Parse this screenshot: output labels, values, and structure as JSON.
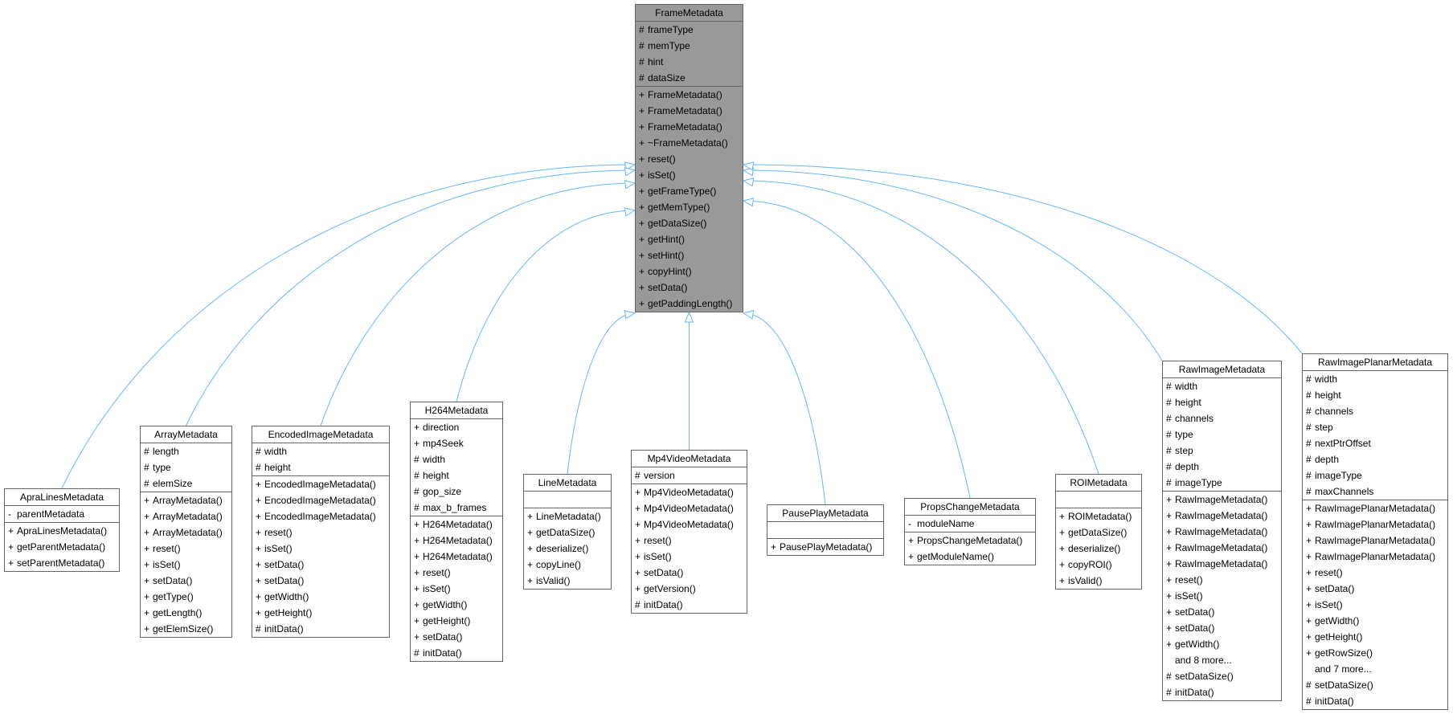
{
  "diagram": {
    "type": "class-inheritance",
    "edge_color": "#63b8ff",
    "base": {
      "name": "FrameMetadata",
      "attributes": [
        {
          "vis": "#",
          "name": "frameType"
        },
        {
          "vis": "#",
          "name": "memType"
        },
        {
          "vis": "#",
          "name": "hint"
        },
        {
          "vis": "#",
          "name": "dataSize"
        }
      ],
      "methods": [
        {
          "vis": "+",
          "name": "FrameMetadata()"
        },
        {
          "vis": "+",
          "name": "FrameMetadata()"
        },
        {
          "vis": "+",
          "name": "FrameMetadata()"
        },
        {
          "vis": "+",
          "name": "~FrameMetadata()"
        },
        {
          "vis": "+",
          "name": "reset()"
        },
        {
          "vis": "+",
          "name": "isSet()"
        },
        {
          "vis": "+",
          "name": "getFrameType()"
        },
        {
          "vis": "+",
          "name": "getMemType()"
        },
        {
          "vis": "+",
          "name": "getDataSize()"
        },
        {
          "vis": "+",
          "name": "getHint()"
        },
        {
          "vis": "+",
          "name": "setHint()"
        },
        {
          "vis": "+",
          "name": "copyHint()"
        },
        {
          "vis": "+",
          "name": "setData()"
        },
        {
          "vis": "+",
          "name": "getPaddingLength()"
        }
      ]
    },
    "classes": [
      {
        "name": "ApraLinesMetadata",
        "attributes": [
          {
            "vis": "-",
            "name": "parentMetadata"
          }
        ],
        "methods": [
          {
            "vis": "+",
            "name": "ApraLinesMetadata()"
          },
          {
            "vis": "+",
            "name": "getParentMetadata()"
          },
          {
            "vis": "+",
            "name": "setParentMetadata()"
          }
        ]
      },
      {
        "name": "ArrayMetadata",
        "attributes": [
          {
            "vis": "#",
            "name": "length"
          },
          {
            "vis": "#",
            "name": "type"
          },
          {
            "vis": "#",
            "name": "elemSize"
          }
        ],
        "methods": [
          {
            "vis": "+",
            "name": "ArrayMetadata()"
          },
          {
            "vis": "+",
            "name": "ArrayMetadata()"
          },
          {
            "vis": "+",
            "name": "ArrayMetadata()"
          },
          {
            "vis": "+",
            "name": "reset()"
          },
          {
            "vis": "+",
            "name": "isSet()"
          },
          {
            "vis": "+",
            "name": "setData()"
          },
          {
            "vis": "+",
            "name": "getType()"
          },
          {
            "vis": "+",
            "name": "getLength()"
          },
          {
            "vis": "+",
            "name": "getElemSize()"
          }
        ]
      },
      {
        "name": "EncodedImageMetadata",
        "attributes": [
          {
            "vis": "#",
            "name": "width"
          },
          {
            "vis": "#",
            "name": "height"
          }
        ],
        "methods": [
          {
            "vis": "+",
            "name": "EncodedImageMetadata()"
          },
          {
            "vis": "+",
            "name": "EncodedImageMetadata()"
          },
          {
            "vis": "+",
            "name": "EncodedImageMetadata()"
          },
          {
            "vis": "+",
            "name": "reset()"
          },
          {
            "vis": "+",
            "name": "isSet()"
          },
          {
            "vis": "+",
            "name": "setData()"
          },
          {
            "vis": "+",
            "name": "setData()"
          },
          {
            "vis": "+",
            "name": "getWidth()"
          },
          {
            "vis": "+",
            "name": "getHeight()"
          },
          {
            "vis": "#",
            "name": "initData()"
          }
        ]
      },
      {
        "name": "H264Metadata",
        "attributes": [
          {
            "vis": "+",
            "name": "direction"
          },
          {
            "vis": "+",
            "name": "mp4Seek"
          },
          {
            "vis": "#",
            "name": "width"
          },
          {
            "vis": "#",
            "name": "height"
          },
          {
            "vis": "#",
            "name": "gop_size"
          },
          {
            "vis": "#",
            "name": "max_b_frames"
          }
        ],
        "methods": [
          {
            "vis": "+",
            "name": "H264Metadata()"
          },
          {
            "vis": "+",
            "name": "H264Metadata()"
          },
          {
            "vis": "+",
            "name": "H264Metadata()"
          },
          {
            "vis": "+",
            "name": "reset()"
          },
          {
            "vis": "+",
            "name": "isSet()"
          },
          {
            "vis": "+",
            "name": "getWidth()"
          },
          {
            "vis": "+",
            "name": "getHeight()"
          },
          {
            "vis": "+",
            "name": "setData()"
          },
          {
            "vis": "#",
            "name": "initData()"
          }
        ]
      },
      {
        "name": "LineMetadata",
        "attributes": [],
        "methods": [
          {
            "vis": "+",
            "name": "LineMetadata()"
          },
          {
            "vis": "+",
            "name": "getDataSize()"
          },
          {
            "vis": "+",
            "name": "deserialize()"
          },
          {
            "vis": "+",
            "name": "copyLine()"
          },
          {
            "vis": "+",
            "name": "isValid()"
          }
        ]
      },
      {
        "name": "Mp4VideoMetadata",
        "attributes": [
          {
            "vis": "#",
            "name": "version"
          }
        ],
        "methods": [
          {
            "vis": "+",
            "name": "Mp4VideoMetadata()"
          },
          {
            "vis": "+",
            "name": "Mp4VideoMetadata()"
          },
          {
            "vis": "+",
            "name": "Mp4VideoMetadata()"
          },
          {
            "vis": "+",
            "name": "reset()"
          },
          {
            "vis": "+",
            "name": "isSet()"
          },
          {
            "vis": "+",
            "name": "setData()"
          },
          {
            "vis": "+",
            "name": "getVersion()"
          },
          {
            "vis": "#",
            "name": "initData()"
          }
        ]
      },
      {
        "name": "PausePlayMetadata",
        "attributes": [],
        "methods": [
          {
            "vis": "+",
            "name": "PausePlayMetadata()"
          }
        ]
      },
      {
        "name": "PropsChangeMetadata",
        "attributes": [
          {
            "vis": "-",
            "name": "moduleName"
          }
        ],
        "methods": [
          {
            "vis": "+",
            "name": "PropsChangeMetadata()"
          },
          {
            "vis": "+",
            "name": "getModuleName()"
          }
        ]
      },
      {
        "name": "ROIMetadata",
        "attributes": [],
        "methods": [
          {
            "vis": "+",
            "name": "ROIMetadata()"
          },
          {
            "vis": "+",
            "name": "getDataSize()"
          },
          {
            "vis": "+",
            "name": "deserialize()"
          },
          {
            "vis": "+",
            "name": "copyROI()"
          },
          {
            "vis": "+",
            "name": "isValid()"
          }
        ]
      },
      {
        "name": "RawImageMetadata",
        "attributes": [
          {
            "vis": "#",
            "name": "width"
          },
          {
            "vis": "#",
            "name": "height"
          },
          {
            "vis": "#",
            "name": "channels"
          },
          {
            "vis": "#",
            "name": "type"
          },
          {
            "vis": "#",
            "name": "step"
          },
          {
            "vis": "#",
            "name": "depth"
          },
          {
            "vis": "#",
            "name": "imageType"
          }
        ],
        "methods": [
          {
            "vis": "+",
            "name": "RawImageMetadata()"
          },
          {
            "vis": "+",
            "name": "RawImageMetadata()"
          },
          {
            "vis": "+",
            "name": "RawImageMetadata()"
          },
          {
            "vis": "+",
            "name": "RawImageMetadata()"
          },
          {
            "vis": "+",
            "name": "RawImageMetadata()"
          },
          {
            "vis": "+",
            "name": "reset()"
          },
          {
            "vis": "+",
            "name": "isSet()"
          },
          {
            "vis": "+",
            "name": "setData()"
          },
          {
            "vis": "+",
            "name": "setData()"
          },
          {
            "vis": "+",
            "name": "getWidth()"
          },
          {
            "vis": "",
            "name": "and 8 more..."
          },
          {
            "vis": "#",
            "name": "setDataSize()"
          },
          {
            "vis": "#",
            "name": "initData()"
          }
        ]
      },
      {
        "name": "RawImagePlanarMetadata",
        "attributes": [
          {
            "vis": "#",
            "name": "width"
          },
          {
            "vis": "#",
            "name": "height"
          },
          {
            "vis": "#",
            "name": "channels"
          },
          {
            "vis": "#",
            "name": "step"
          },
          {
            "vis": "#",
            "name": "nextPtrOffset"
          },
          {
            "vis": "#",
            "name": "depth"
          },
          {
            "vis": "#",
            "name": "imageType"
          },
          {
            "vis": "#",
            "name": "maxChannels"
          }
        ],
        "methods": [
          {
            "vis": "+",
            "name": "RawImagePlanarMetadata()"
          },
          {
            "vis": "+",
            "name": "RawImagePlanarMetadata()"
          },
          {
            "vis": "+",
            "name": "RawImagePlanarMetadata()"
          },
          {
            "vis": "+",
            "name": "RawImagePlanarMetadata()"
          },
          {
            "vis": "+",
            "name": "reset()"
          },
          {
            "vis": "+",
            "name": "setData()"
          },
          {
            "vis": "+",
            "name": "isSet()"
          },
          {
            "vis": "+",
            "name": "getWidth()"
          },
          {
            "vis": "+",
            "name": "getHeight()"
          },
          {
            "vis": "+",
            "name": "getRowSize()"
          },
          {
            "vis": "",
            "name": "and 7 more..."
          },
          {
            "vis": "#",
            "name": "setDataSize()"
          },
          {
            "vis": "#",
            "name": "initData()"
          }
        ]
      }
    ]
  }
}
